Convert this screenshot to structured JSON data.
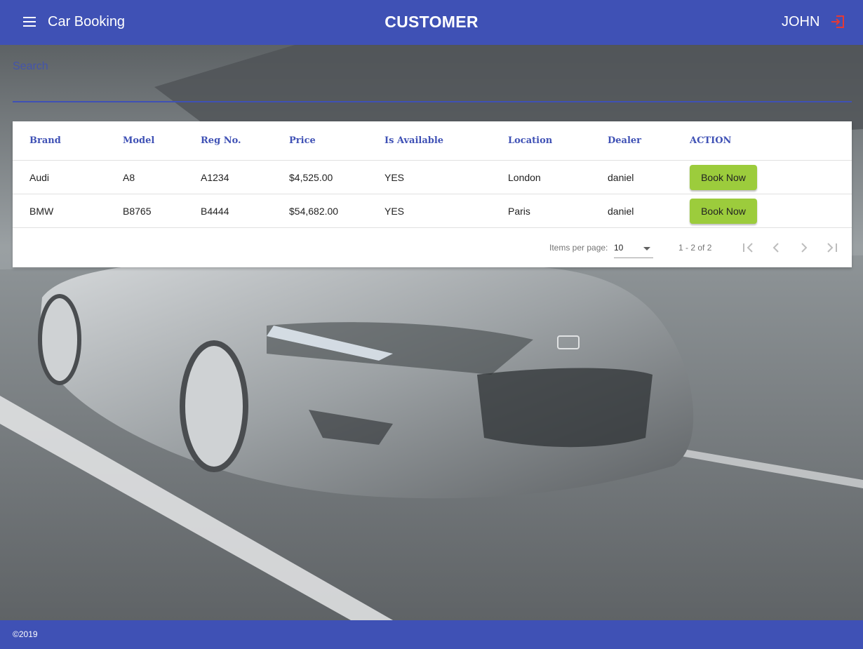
{
  "header": {
    "app_title": "Car Booking",
    "page_title": "CUSTOMER",
    "user_name": "JOHN",
    "menu_icon": "menu-icon",
    "logout_icon": "logout-icon"
  },
  "search": {
    "placeholder": "Search",
    "value": ""
  },
  "table": {
    "columns": [
      "Brand",
      "Model",
      "Reg No.",
      "Price",
      "Is Available",
      "Location",
      "Dealer",
      "ACTION"
    ],
    "rows": [
      {
        "brand": "Audi",
        "model": "A8",
        "reg_no": "A1234",
        "price": "$4,525.00",
        "available": "YES",
        "location": "London",
        "dealer": "daniel",
        "action": "Book Now"
      },
      {
        "brand": "BMW",
        "model": "B8765",
        "reg_no": "B4444",
        "price": "$54,682.00",
        "available": "YES",
        "location": "Paris",
        "dealer": "daniel",
        "action": "Book Now"
      }
    ]
  },
  "paginator": {
    "items_per_page_label": "Items per page:",
    "items_per_page_value": "10",
    "range_label": "1 - 2 of 2"
  },
  "footer": {
    "copyright": "©2019"
  },
  "colors": {
    "primary": "#3f51b5",
    "action_button": "#9ccc3c",
    "logout_icon": "#e53935"
  }
}
